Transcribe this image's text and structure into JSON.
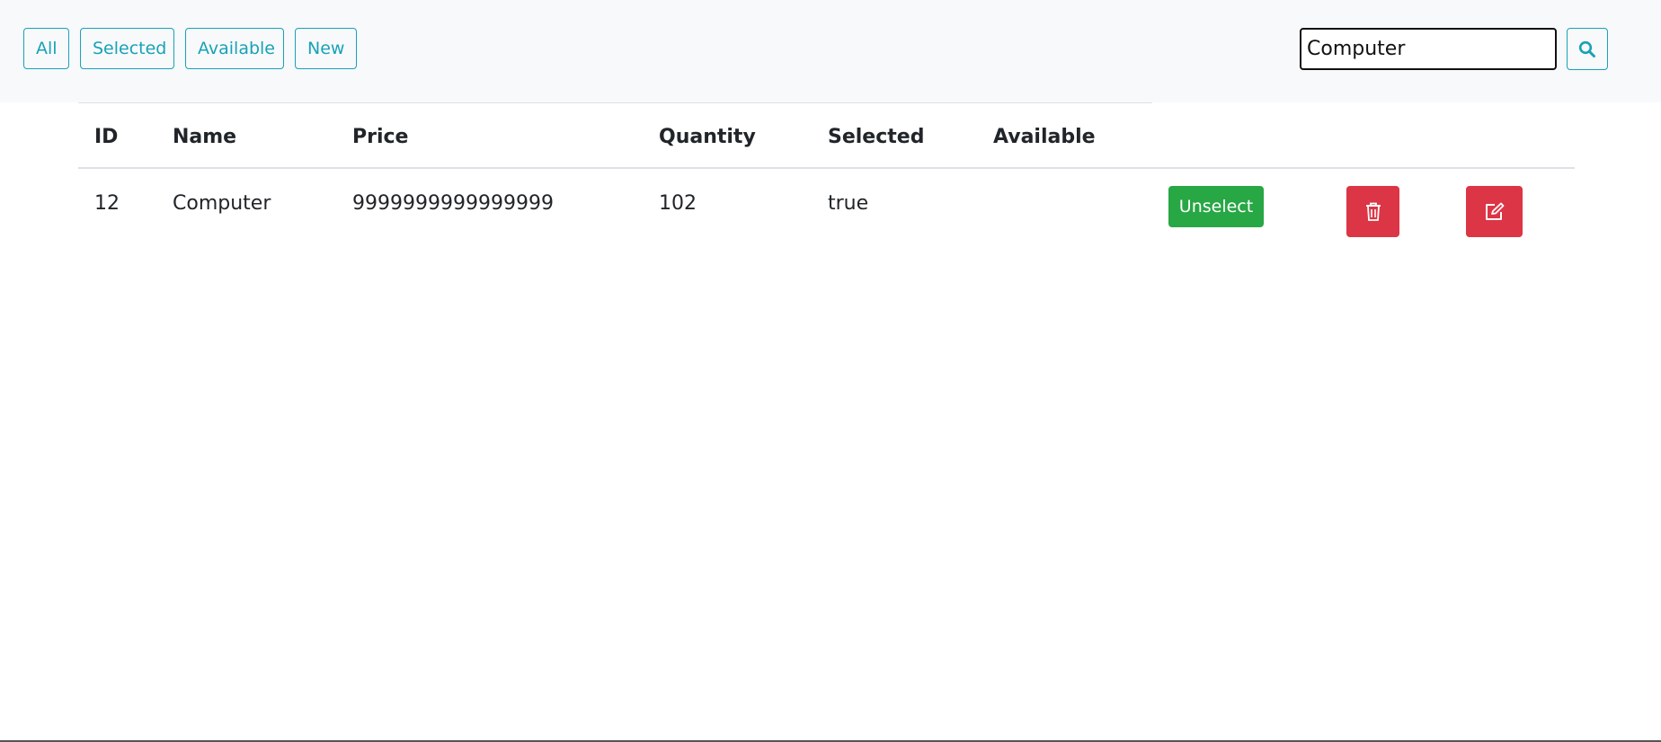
{
  "toolbar": {
    "filters": {
      "all": "All",
      "selected": "Selected",
      "available": "Available",
      "new": "New"
    },
    "search": {
      "value": "Computer",
      "icon": "search-icon"
    }
  },
  "table": {
    "headers": {
      "id": "ID",
      "name": "Name",
      "price": "Price",
      "quantity": "Quantity",
      "selected": "Selected",
      "available": "Available"
    },
    "rows": [
      {
        "id": "12",
        "name": "Computer",
        "price": "9999999999999999",
        "quantity": "102",
        "selected": "true",
        "available": "",
        "select_action": "Unselect",
        "delete_icon": "trash-icon",
        "edit_icon": "edit-icon"
      }
    ]
  },
  "colors": {
    "outline_accent": "#17a2b8",
    "success": "#28a745",
    "danger": "#dc3545",
    "navbar_bg": "#f8f9fa"
  }
}
